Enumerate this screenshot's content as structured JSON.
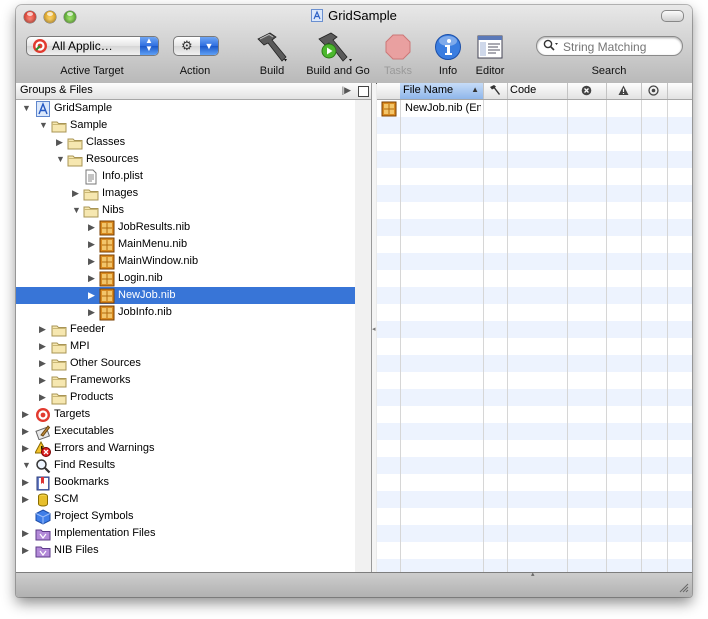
{
  "window": {
    "title": "GridSample"
  },
  "toolbar": {
    "active_target": {
      "value": "All Applic…",
      "label": "Active Target"
    },
    "action": {
      "label": "Action"
    },
    "build": {
      "label": "Build"
    },
    "build_and_go": {
      "label": "Build and Go"
    },
    "tasks": {
      "label": "Tasks"
    },
    "info": {
      "label": "Info"
    },
    "editor": {
      "label": "Editor"
    },
    "search": {
      "placeholder": "String Matching",
      "label": "Search"
    }
  },
  "groups": {
    "header": "Groups & Files",
    "items": [
      {
        "label": "GridSample",
        "icon": "xcode-project-icon",
        "expanded": true
      },
      {
        "label": "Sample",
        "icon": "folder-icon",
        "expanded": true
      },
      {
        "label": "Classes",
        "icon": "folder-icon"
      },
      {
        "label": "Resources",
        "icon": "folder-icon",
        "expanded": true
      },
      {
        "label": "Info.plist",
        "icon": "plist-file-icon"
      },
      {
        "label": "Images",
        "icon": "folder-icon"
      },
      {
        "label": "Nibs",
        "icon": "folder-icon",
        "expanded": true
      },
      {
        "label": "JobResults.nib",
        "icon": "nib-file-icon"
      },
      {
        "label": "MainMenu.nib",
        "icon": "nib-file-icon"
      },
      {
        "label": "MainWindow.nib",
        "icon": "nib-file-icon"
      },
      {
        "label": "Login.nib",
        "icon": "nib-file-icon"
      },
      {
        "label": "NewJob.nib",
        "icon": "nib-file-icon",
        "selected": true
      },
      {
        "label": "JobInfo.nib",
        "icon": "nib-file-icon"
      },
      {
        "label": "Feeder",
        "icon": "folder-icon"
      },
      {
        "label": "MPI",
        "icon": "folder-icon"
      },
      {
        "label": "Other Sources",
        "icon": "folder-icon"
      },
      {
        "label": "Frameworks",
        "icon": "folder-icon"
      },
      {
        "label": "Products",
        "icon": "folder-icon"
      },
      {
        "label": "Targets",
        "icon": "target-icon"
      },
      {
        "label": "Executables",
        "icon": "executables-icon"
      },
      {
        "label": "Errors and Warnings",
        "icon": "warning-icon"
      },
      {
        "label": "Find Results",
        "icon": "magnifier-icon",
        "expanded": true
      },
      {
        "label": "Bookmarks",
        "icon": "bookmarks-icon"
      },
      {
        "label": "SCM",
        "icon": "scm-icon"
      },
      {
        "label": "Project Symbols",
        "icon": "symbols-cube-icon"
      },
      {
        "label": "Implementation Files",
        "icon": "smart-group-icon"
      },
      {
        "label": "NIB Files",
        "icon": "smart-group-icon"
      }
    ]
  },
  "detail": {
    "columns": {
      "file_name": "File Name",
      "code": "Code",
      "build_icon": "hammer-icon",
      "errors_icon": "error-icon",
      "warnings_icon": "warning-triangle-icon",
      "target_icon": "target-dot-icon"
    },
    "rows": [
      {
        "file_name": "NewJob.nib (En",
        "icon": "nib-file-icon"
      }
    ]
  },
  "colors": {
    "selection": "#3875d7",
    "stripe": "#edf3fe",
    "sort_header": "#a9c8f0"
  }
}
